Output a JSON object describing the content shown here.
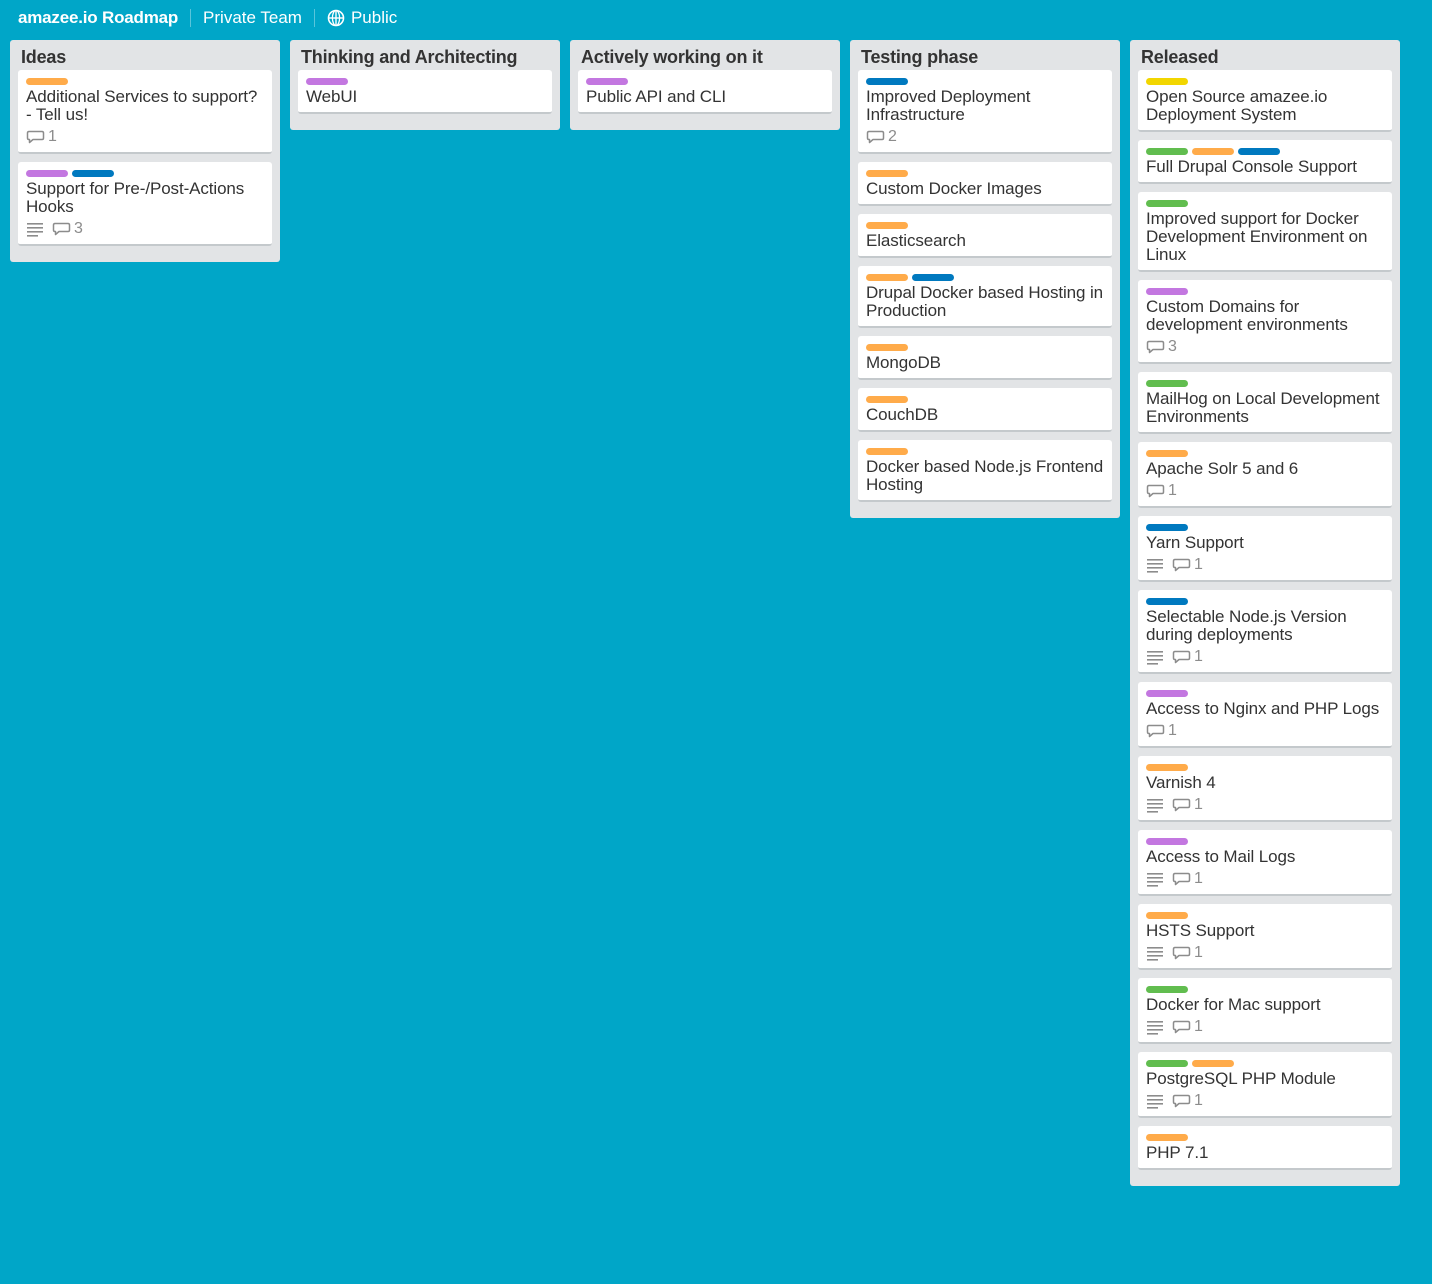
{
  "header": {
    "board_title": "amazee.io Roadmap",
    "team": "Private Team",
    "visibility": "Public",
    "visibility_icon": "globe-icon"
  },
  "colors": {
    "background": "#00a6c8",
    "orange": "#ffab4a",
    "blue": "#0079bf",
    "purple": "#c377e0",
    "green": "#61bd4f",
    "yellow": "#f2d600"
  },
  "lists": [
    {
      "title": "Ideas",
      "cards": [
        {
          "title": "Additional Services to support? - Tell us!",
          "labels": [
            "orange"
          ],
          "description": false,
          "comments": "1"
        },
        {
          "title": "Support for Pre-/Post-Actions Hooks",
          "labels": [
            "purple",
            "blue"
          ],
          "description": true,
          "comments": "3"
        }
      ]
    },
    {
      "title": "Thinking and Architecting",
      "cards": [
        {
          "title": "WebUI",
          "labels": [
            "purple"
          ],
          "description": false,
          "comments": null
        }
      ]
    },
    {
      "title": "Actively working on it",
      "cards": [
        {
          "title": "Public API and CLI",
          "labels": [
            "purple"
          ],
          "description": false,
          "comments": null
        }
      ]
    },
    {
      "title": "Testing phase",
      "cards": [
        {
          "title": "Improved Deployment Infrastructure",
          "labels": [
            "blue"
          ],
          "description": false,
          "comments": "2"
        },
        {
          "title": "Custom Docker Images",
          "labels": [
            "orange"
          ],
          "description": false,
          "comments": null
        },
        {
          "title": "Elasticsearch",
          "labels": [
            "orange"
          ],
          "description": false,
          "comments": null
        },
        {
          "title": "Drupal Docker based Hosting in Production",
          "labels": [
            "orange",
            "blue"
          ],
          "description": false,
          "comments": null
        },
        {
          "title": "MongoDB",
          "labels": [
            "orange"
          ],
          "description": false,
          "comments": null
        },
        {
          "title": "CouchDB",
          "labels": [
            "orange"
          ],
          "description": false,
          "comments": null
        },
        {
          "title": "Docker based Node.js Frontend Hosting",
          "labels": [
            "orange"
          ],
          "description": false,
          "comments": null
        }
      ]
    },
    {
      "title": "Released",
      "cards": [
        {
          "title": "Open Source amazee.io Deployment System",
          "labels": [
            "yellow"
          ],
          "description": false,
          "comments": null
        },
        {
          "title": "Full Drupal Console Support",
          "labels": [
            "green",
            "orange",
            "blue"
          ],
          "description": false,
          "comments": null
        },
        {
          "title": "Improved support for Docker Development Environment on Linux",
          "labels": [
            "green"
          ],
          "description": false,
          "comments": null
        },
        {
          "title": "Custom Domains for development environments",
          "labels": [
            "purple"
          ],
          "description": false,
          "comments": "3"
        },
        {
          "title": "MailHog on Local Development Environments",
          "labels": [
            "green"
          ],
          "description": false,
          "comments": null
        },
        {
          "title": "Apache Solr 5 and 6",
          "labels": [
            "orange"
          ],
          "description": false,
          "comments": "1"
        },
        {
          "title": "Yarn Support",
          "labels": [
            "blue"
          ],
          "description": true,
          "comments": "1"
        },
        {
          "title": "Selectable Node.js Version during deployments",
          "labels": [
            "blue"
          ],
          "description": true,
          "comments": "1"
        },
        {
          "title": "Access to Nginx and PHP Logs",
          "labels": [
            "purple"
          ],
          "description": false,
          "comments": "1"
        },
        {
          "title": "Varnish 4",
          "labels": [
            "orange"
          ],
          "description": true,
          "comments": "1"
        },
        {
          "title": "Access to Mail Logs",
          "labels": [
            "purple"
          ],
          "description": true,
          "comments": "1"
        },
        {
          "title": "HSTS Support",
          "labels": [
            "orange"
          ],
          "description": true,
          "comments": "1"
        },
        {
          "title": "Docker for Mac support",
          "labels": [
            "green"
          ],
          "description": true,
          "comments": "1"
        },
        {
          "title": "PostgreSQL PHP Module",
          "labels": [
            "green",
            "orange"
          ],
          "description": true,
          "comments": "1"
        },
        {
          "title": "PHP 7.1",
          "labels": [
            "orange"
          ],
          "description": false,
          "comments": null
        }
      ]
    }
  ]
}
